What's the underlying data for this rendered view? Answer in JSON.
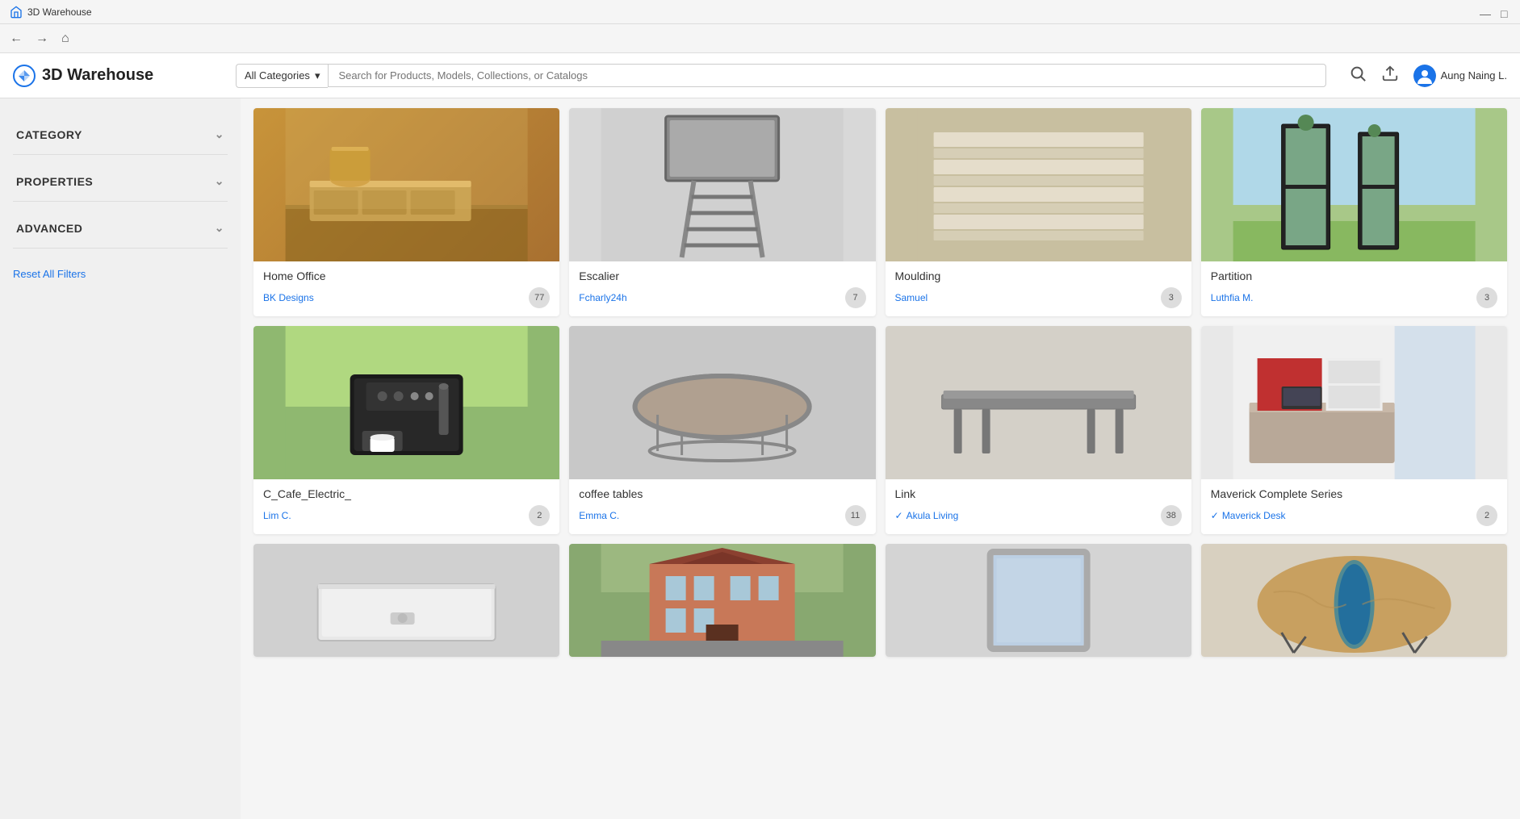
{
  "titleBar": {
    "title": "3D Warehouse",
    "minimizeBtn": "—",
    "maximizeBtn": "□"
  },
  "nav": {
    "backBtn": "←",
    "forwardBtn": "→",
    "homeBtn": "⌂"
  },
  "header": {
    "logoText": "3D Warehouse",
    "categoryDropdown": "All Categories",
    "searchPlaceholder": "Search for Products, Models, Collections, or Catalogs",
    "userName": "Aung Naing L."
  },
  "sidebar": {
    "filters": [
      {
        "id": "category",
        "label": "CATEGORY"
      },
      {
        "id": "properties",
        "label": "PROPERTIES"
      },
      {
        "id": "advanced",
        "label": "ADVANCED"
      }
    ],
    "resetLabel": "Reset All Filters"
  },
  "grid": {
    "cards": [
      {
        "id": "home-office",
        "title": "Home Office",
        "author": "BK Designs",
        "verified": false,
        "count": "77",
        "bgColor": "#c8943a",
        "imageType": "office"
      },
      {
        "id": "escalier",
        "title": "Escalier",
        "author": "Fcharly24h",
        "verified": false,
        "count": "7",
        "bgColor": "#d0d0d0",
        "imageType": "escalier"
      },
      {
        "id": "moulding",
        "title": "Moulding",
        "author": "Samuel",
        "verified": false,
        "count": "3",
        "bgColor": "#c8bfa0",
        "imageType": "moulding"
      },
      {
        "id": "partition",
        "title": "Partition",
        "author": "Luthfia M.",
        "verified": false,
        "count": "3",
        "bgColor": "#a8c888",
        "imageType": "partition"
      },
      {
        "id": "cafe-electric",
        "title": "C_Cafe_Electric_",
        "author": "Lim C.",
        "verified": false,
        "count": "2",
        "bgColor": "#8fb870",
        "imageType": "coffee-machine"
      },
      {
        "id": "coffee-tables",
        "title": "coffee tables",
        "author": "Emma C.",
        "verified": false,
        "count": "11",
        "bgColor": "#c8c8c8",
        "imageType": "coffee-table"
      },
      {
        "id": "link",
        "title": "Link",
        "author": "Akula Living",
        "verified": true,
        "count": "38",
        "bgColor": "#d4d0c8",
        "imageType": "link-table"
      },
      {
        "id": "maverick",
        "title": "Maverick Complete Series",
        "author": "Maverick Desk",
        "verified": true,
        "count": "2",
        "bgColor": "#e8e8e8",
        "imageType": "maverick"
      },
      {
        "id": "shower",
        "title": "",
        "author": "",
        "verified": false,
        "count": "",
        "bgColor": "#d0d0d0",
        "imageType": "shower"
      },
      {
        "id": "building",
        "title": "",
        "author": "",
        "verified": false,
        "count": "",
        "bgColor": "#88a870",
        "imageType": "building"
      },
      {
        "id": "mirror",
        "title": "",
        "author": "",
        "verified": false,
        "count": "",
        "bgColor": "#d4d4d4",
        "imageType": "mirror"
      },
      {
        "id": "river-table",
        "title": "",
        "author": "",
        "verified": false,
        "count": "",
        "bgColor": "#d8d0c0",
        "imageType": "river-table"
      }
    ]
  }
}
